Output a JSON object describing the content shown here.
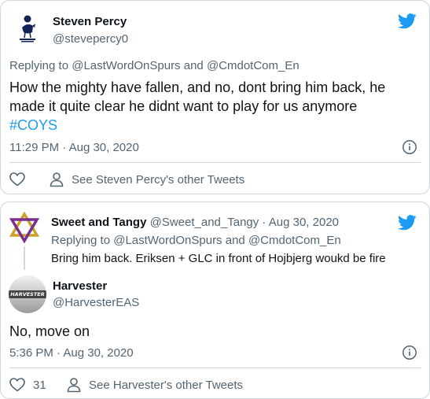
{
  "colors": {
    "twitter_blue": "#1d9bf0",
    "secondary_text": "#536471",
    "primary_text": "#0f1419",
    "border": "#cfd9de"
  },
  "tweet1": {
    "author_name": "Steven Percy",
    "author_handle": "@stevepercy0",
    "replying_prefix": "Replying to",
    "replying_mention1": "@LastWordOnSpurs",
    "replying_and": "and",
    "replying_mention2": "@CmdotCom_En",
    "text": "How the mighty have fallen, and no, dont bring him back, he made it quite clear he didnt want to play for us anymore",
    "hashtag": "#COYS",
    "timestamp": "11:29 PM · Aug 30, 2020",
    "other_tweets_label": "See Steven Percy's other Tweets",
    "avatar_icon": "spurs-crest-icon"
  },
  "tweet2_parent": {
    "author_name": "Sweet and Tangy",
    "author_handle": "@Sweet_and_Tangy",
    "date": "· Aug 30, 2020",
    "replying_prefix": "Replying to",
    "replying_mention1": "@LastWordOnSpurs",
    "replying_and": "and",
    "replying_mention2": "@CmdotCom_En",
    "text": "Bring him back. Eriksen + GLC in front of Hojbjerg woukd be fire",
    "avatar_icon": "star-of-david-icon"
  },
  "tweet2": {
    "author_name": "Harvester",
    "author_handle": "@HarvesterEAS",
    "avatar_text": "HARVESTER",
    "text": "No, move on",
    "timestamp": "5:36 PM · Aug 30, 2020",
    "like_count": "31",
    "other_tweets_label": "See Harvester's other Tweets"
  }
}
